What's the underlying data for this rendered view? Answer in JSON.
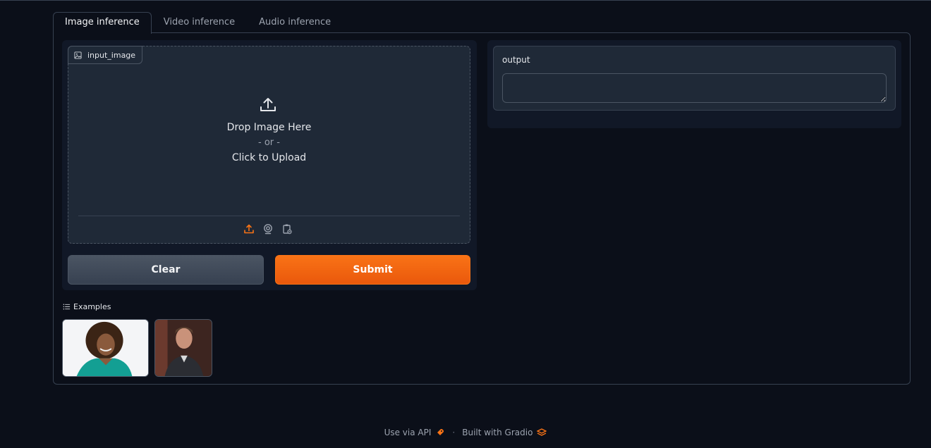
{
  "tabs": [
    {
      "label": "Image inference",
      "active": true
    },
    {
      "label": "Video inference",
      "active": false
    },
    {
      "label": "Audio inference",
      "active": false
    }
  ],
  "input": {
    "label": "input_image",
    "icon": "image-icon",
    "drop_text": "Drop Image Here",
    "or_text": "- or -",
    "click_text": "Click to Upload",
    "sources": [
      "upload-icon",
      "webcam-icon",
      "clipboard-icon"
    ]
  },
  "buttons": {
    "clear_label": "Clear",
    "submit_label": "Submit"
  },
  "output": {
    "label": "output",
    "value": ""
  },
  "examples": {
    "label": "Examples",
    "icon": "list-icon",
    "count": 2
  },
  "footer": {
    "api_label": "Use via API",
    "separator": "·",
    "built_label": "Built with Gradio"
  },
  "colors": {
    "accent": "#f97316",
    "background": "#0b0f19",
    "panel": "#111827",
    "block": "#1f2937"
  }
}
